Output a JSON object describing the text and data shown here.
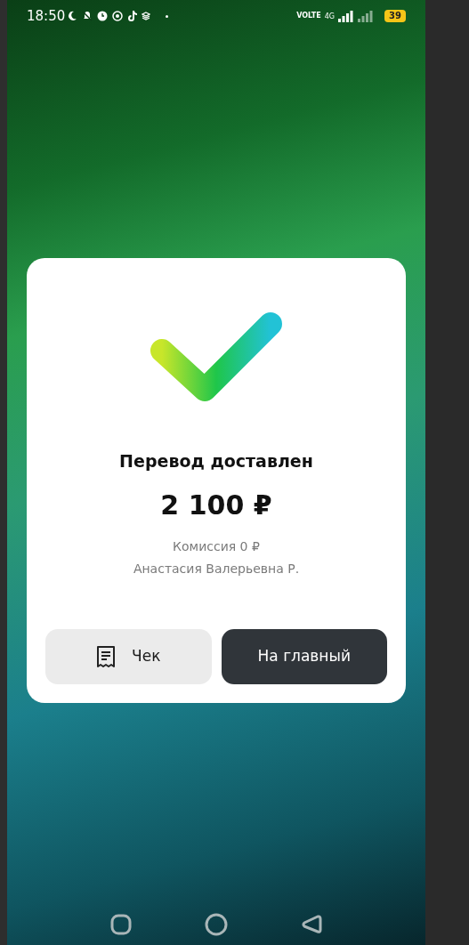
{
  "status_bar": {
    "time": "18:50",
    "volte": "VOLTE",
    "network": "4G",
    "battery": "39"
  },
  "result": {
    "title": "Перевод доставлен",
    "amount": "2 100 ₽",
    "commission": "Комиссия 0 ₽",
    "recipient": "Анастасия Валерьевна Р."
  },
  "buttons": [
    {
      "label": "Чек",
      "kind": "receipt"
    },
    {
      "label": "На главный",
      "kind": "primary"
    }
  ]
}
